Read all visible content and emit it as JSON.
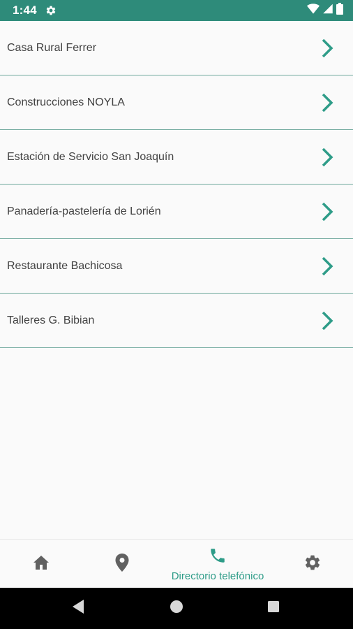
{
  "status_bar": {
    "time": "1:44",
    "icons": [
      "settings-icon",
      "wifi-icon",
      "signal-icon",
      "battery-icon"
    ],
    "background_color": "#2e8b7a"
  },
  "list": {
    "items": [
      {
        "label": "Casa Rural Ferrer",
        "icon": "chevron-right-icon"
      },
      {
        "label": "Construcciones NOYLA",
        "icon": "chevron-right-icon"
      },
      {
        "label": "Estación de Servicio San Joaquín",
        "icon": "chevron-right-icon"
      },
      {
        "label": "Panadería-pastelería de Lorién",
        "icon": "chevron-right-icon"
      },
      {
        "label": "Restaurante Bachicosa",
        "icon": "chevron-right-icon"
      },
      {
        "label": "Talleres G. Bibian",
        "icon": "chevron-right-icon"
      }
    ],
    "accent_color": "#2e9c88"
  },
  "bottom_nav": {
    "items": [
      {
        "icon": "home-icon",
        "label": "",
        "active": false
      },
      {
        "icon": "location-pin-icon",
        "label": "",
        "active": false
      },
      {
        "icon": "phone-icon",
        "label": "Directorio telefónico",
        "active": true
      },
      {
        "icon": "settings-icon",
        "label": "",
        "active": false
      }
    ],
    "active_color": "#2e9c88",
    "inactive_color": "#616161"
  },
  "system_nav": {
    "buttons": [
      "back-icon",
      "home-circle-icon",
      "recents-icon"
    ]
  }
}
